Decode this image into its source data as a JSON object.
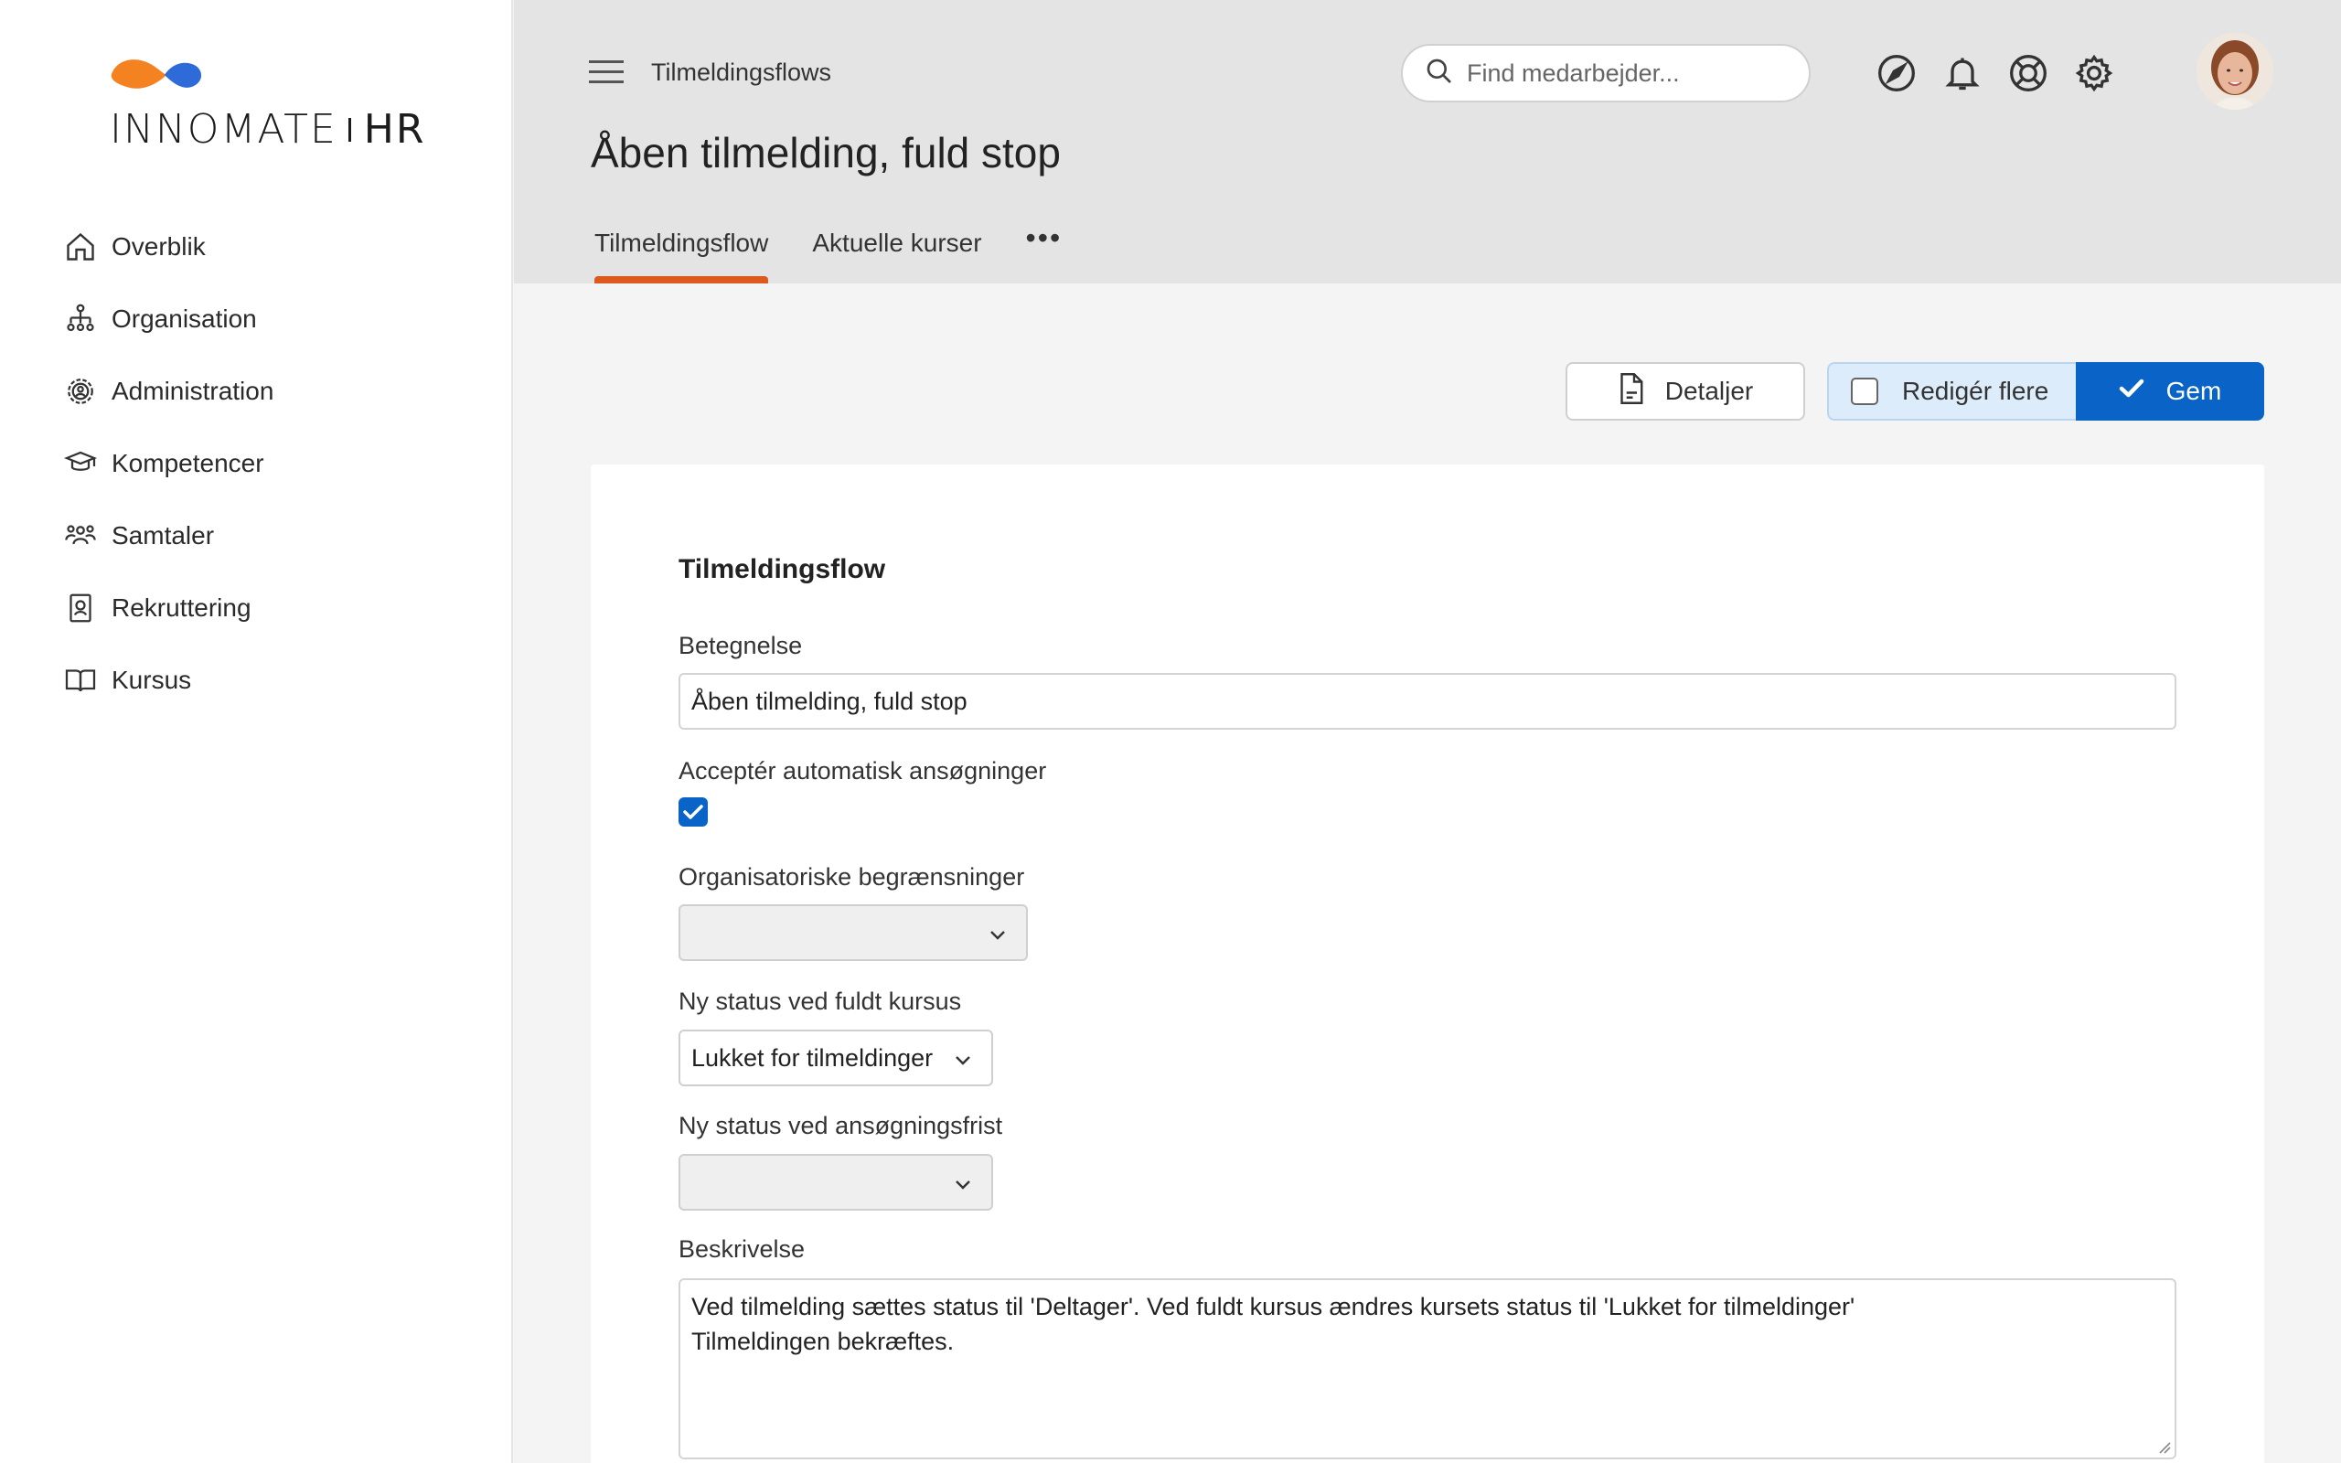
{
  "brand": {
    "name": "INNOMATE",
    "suffix": "HR",
    "colors": {
      "orange": "#F58220",
      "blue": "#2F6BD8",
      "accent": "#DC5A1E",
      "primary": "#0A64C8"
    }
  },
  "sidebar": {
    "items": [
      {
        "label": "Overblik",
        "icon": "home-icon"
      },
      {
        "label": "Organisation",
        "icon": "org-chart-icon"
      },
      {
        "label": "Administration",
        "icon": "gear-person-icon"
      },
      {
        "label": "Kompetencer",
        "icon": "graduation-cap-icon"
      },
      {
        "label": "Samtaler",
        "icon": "people-icon"
      },
      {
        "label": "Rekruttering",
        "icon": "badge-icon"
      },
      {
        "label": "Kursus",
        "icon": "book-icon"
      }
    ]
  },
  "header": {
    "breadcrumb": "Tilmeldingsflows",
    "title": "Åben tilmelding, fuld stop",
    "tabs": [
      {
        "label": "Tilmeldingsflow",
        "active": true
      },
      {
        "label": "Aktuelle kurser",
        "active": false
      }
    ],
    "more": "•••",
    "search_placeholder": "Find medarbejder...",
    "icons": [
      "navigation-icon",
      "bell-icon",
      "lifebuoy-icon",
      "gear-icon"
    ]
  },
  "toolbar": {
    "details_label": "Detaljer",
    "edit_multiple_label": "Redigér flere",
    "save_label": "Gem"
  },
  "form": {
    "section_title": "Tilmeldingsflow",
    "name_label": "Betegnelse",
    "name_value": "Åben tilmelding, fuld stop",
    "auto_accept_label": "Acceptér automatisk ansøgninger",
    "auto_accept_checked": true,
    "org_limits_label": "Organisatoriske begrænsninger",
    "org_limits_value": "",
    "status_full_label": "Ny status ved fuldt kursus",
    "status_full_value": "Lukket for tilmeldinger",
    "status_deadline_label": "Ny status ved ansøgningsfrist",
    "status_deadline_value": "",
    "description_label": "Beskrivelse",
    "description_line1": "Ved tilmelding sættes status til 'Deltager'. Ved fuldt kursus ændres kursets status til 'Lukket for tilmeldinger'",
    "description_line2": "Tilmeldingen bekræftes."
  }
}
